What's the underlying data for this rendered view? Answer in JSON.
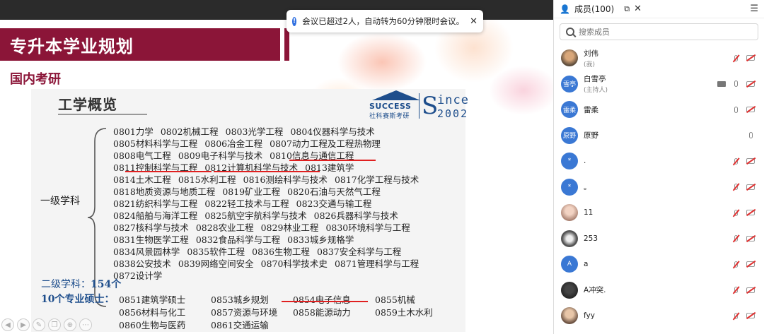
{
  "toast": {
    "text": "会议已超过2人，自动转为60分钟限时会议。",
    "close": "✕"
  },
  "slide": {
    "title": "专升本学业规划",
    "subtitle": "国内考研",
    "section_title": "工学概览",
    "logo": {
      "success": "SUCCESS",
      "cn": "社科赛斯考研",
      "s": "S",
      "since": "ince",
      "year": "2002"
    },
    "level1_label": "一级学科",
    "disciplines": [
      [
        "0801力学",
        "0802机械工程",
        "0803光学工程",
        "0804仪器科学与技术"
      ],
      [
        "0805材料科学与工程",
        "0806冶金工程",
        "0807动力工程及工程热物理"
      ],
      [
        "0808电气工程",
        "0809电子科学与技术",
        "0810信息与通信工程"
      ],
      [
        "0811控制科学与工程",
        "0812计算机科学与技术",
        "0813建筑学"
      ],
      [
        "0814土木工程",
        "0815水利工程",
        "0816测绘科学与技术",
        "0817化学工程与技术"
      ],
      [
        "0818地质资源与地质工程",
        "0819矿业工程",
        "0820石油与天然气工程"
      ],
      [
        "0821纺织科学与工程",
        "0822轻工技术与工程",
        "0823交通与输工程"
      ],
      [
        "0824船舶与海洋工程",
        "0825航空宇航科学与技术",
        "0826兵器科学与技术"
      ],
      [
        "0827核科学与技术",
        "0828农业工程",
        "0829林业工程",
        "0830环境科学与工程"
      ],
      [
        "0831生物医学工程",
        "0832食品科学与工程",
        "0833城乡规格学"
      ],
      [
        "0834风景园林学",
        "0835软件工程",
        "0836生物工程",
        "0837安全科学与工程"
      ],
      [
        "0838公安技术",
        "0839网络空间安全",
        "0870科学技术史",
        "0871管理科学与工程"
      ],
      [
        "0872设计学"
      ]
    ],
    "level2_label": "二级学科：",
    "level2_count": "154个",
    "prof_label": "10个专业硕士：",
    "prof_rows": [
      [
        "0851建筑学硕士",
        "0853城乡规划",
        "0854电子信息",
        "0855机械"
      ],
      [
        "0856材料与化工",
        "0857资源与环境",
        "0858能源动力",
        "0859土木水利"
      ],
      [
        "0860生物与医药",
        "0861交通运输"
      ]
    ]
  },
  "panel": {
    "title": "成员(100)",
    "search_placeholder": "搜索成员",
    "members": [
      {
        "name": "刘伟",
        "role": "(我)",
        "avatar": "photo1",
        "initials": "",
        "icons": [
          "mic-off",
          "cam-off"
        ]
      },
      {
        "name": "白雪亭",
        "role": "(主持人)",
        "avatar": "blue",
        "initials": "雪亭",
        "icons": [
          "screen",
          "mic",
          "cam-off"
        ]
      },
      {
        "name": "雷柔",
        "role": "",
        "avatar": "blue",
        "initials": "雷柔",
        "icons": [
          "mic",
          "cam-off"
        ]
      },
      {
        "name": "原野",
        "role": "",
        "avatar": "blue",
        "initials": "原野",
        "icons": [
          "mic"
        ]
      },
      {
        "name": ".",
        "role": "",
        "avatar": "blue",
        "initials": "*",
        "icons": [
          "mic-off",
          "cam-off"
        ]
      },
      {
        "name": "。",
        "role": "",
        "avatar": "blue",
        "initials": "*",
        "icons": [
          "mic-off",
          "cam-off"
        ]
      },
      {
        "name": "11",
        "role": "",
        "avatar": "photo2",
        "initials": "",
        "icons": [
          "mic-off",
          "cam-off"
        ]
      },
      {
        "name": "253",
        "role": "",
        "avatar": "photo3",
        "initials": "",
        "icons": [
          "mic-off",
          "cam-off"
        ]
      },
      {
        "name": "a",
        "role": "",
        "avatar": "blue",
        "initials": "A",
        "icons": [
          "mic-off",
          "cam-off"
        ]
      },
      {
        "name": "A冲突.",
        "role": "",
        "avatar": "photo4",
        "initials": "",
        "icons": [
          "mic-off",
          "cam-off"
        ]
      },
      {
        "name": "fyy",
        "role": "",
        "avatar": "photo5",
        "initials": "",
        "icons": [
          "mic-off",
          "cam-off"
        ]
      }
    ]
  }
}
